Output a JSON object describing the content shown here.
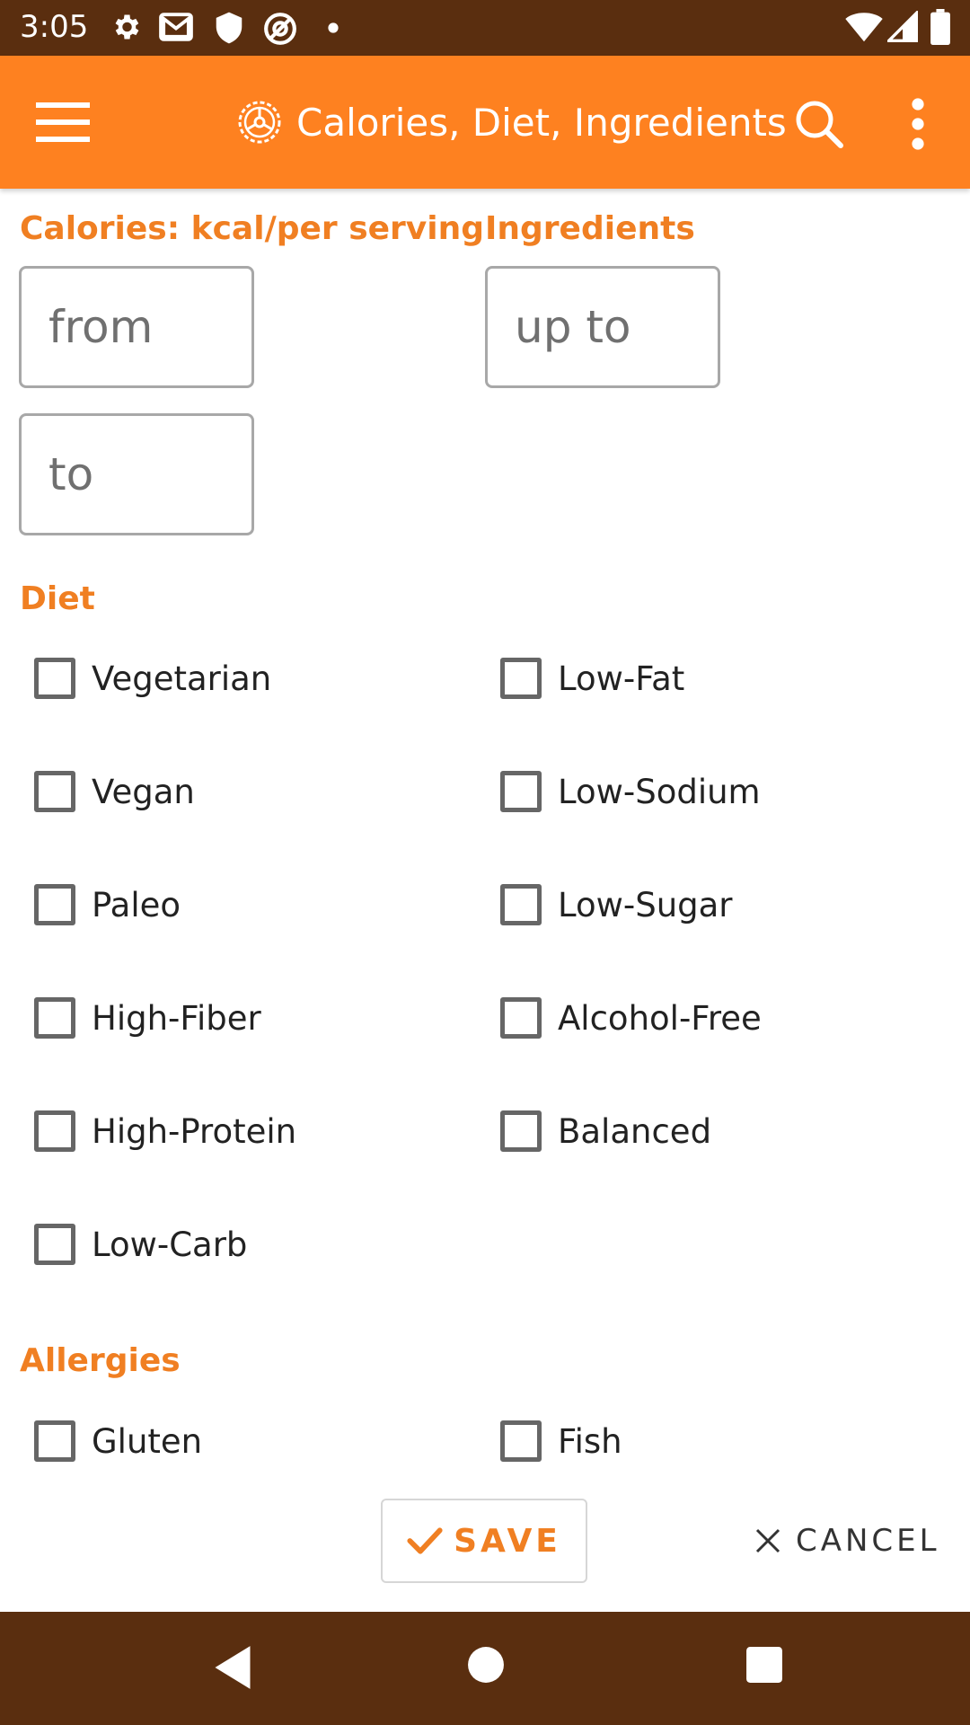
{
  "status_bar": {
    "time": "3:05",
    "icons": [
      "settings-icon",
      "gmail-icon",
      "shield-icon",
      "at-sign-icon",
      "dot-icon",
      "wifi-icon",
      "cell-signal-icon",
      "battery-icon"
    ]
  },
  "app_bar": {
    "title": "Calories, Diet, Ingredients",
    "icons": [
      "menu-icon",
      "filter-gear-icon",
      "search-icon",
      "more-vert-icon"
    ]
  },
  "calories": {
    "label": "Calories: kcal/per serving",
    "from_placeholder": "from",
    "to_placeholder": "to",
    "from_value": "",
    "to_value": ""
  },
  "ingredients": {
    "label": "Ingredients",
    "up_to_placeholder": "up to",
    "up_to_value": ""
  },
  "diet": {
    "label": "Diet",
    "options": [
      {
        "label": "Vegetarian",
        "checked": false
      },
      {
        "label": "Low-Fat",
        "checked": false
      },
      {
        "label": "Vegan",
        "checked": false
      },
      {
        "label": "Low-Sodium",
        "checked": false
      },
      {
        "label": "Paleo",
        "checked": false
      },
      {
        "label": "Low-Sugar",
        "checked": false
      },
      {
        "label": "High-Fiber",
        "checked": false
      },
      {
        "label": "Alcohol-Free",
        "checked": false
      },
      {
        "label": "High-Protein",
        "checked": false
      },
      {
        "label": "Balanced",
        "checked": false
      },
      {
        "label": "Low-Carb",
        "checked": false
      }
    ]
  },
  "allergies": {
    "label": "Allergies",
    "options": [
      {
        "label": "Gluten",
        "checked": false
      },
      {
        "label": "Fish",
        "checked": false
      }
    ]
  },
  "actions": {
    "save_label": "SAVE",
    "cancel_label": "CANCEL"
  },
  "colors": {
    "accent": "#fe8120",
    "label_orange": "#f07f22",
    "status_bar": "#5a2e0f",
    "nav_bar": "#5a2e0f"
  }
}
